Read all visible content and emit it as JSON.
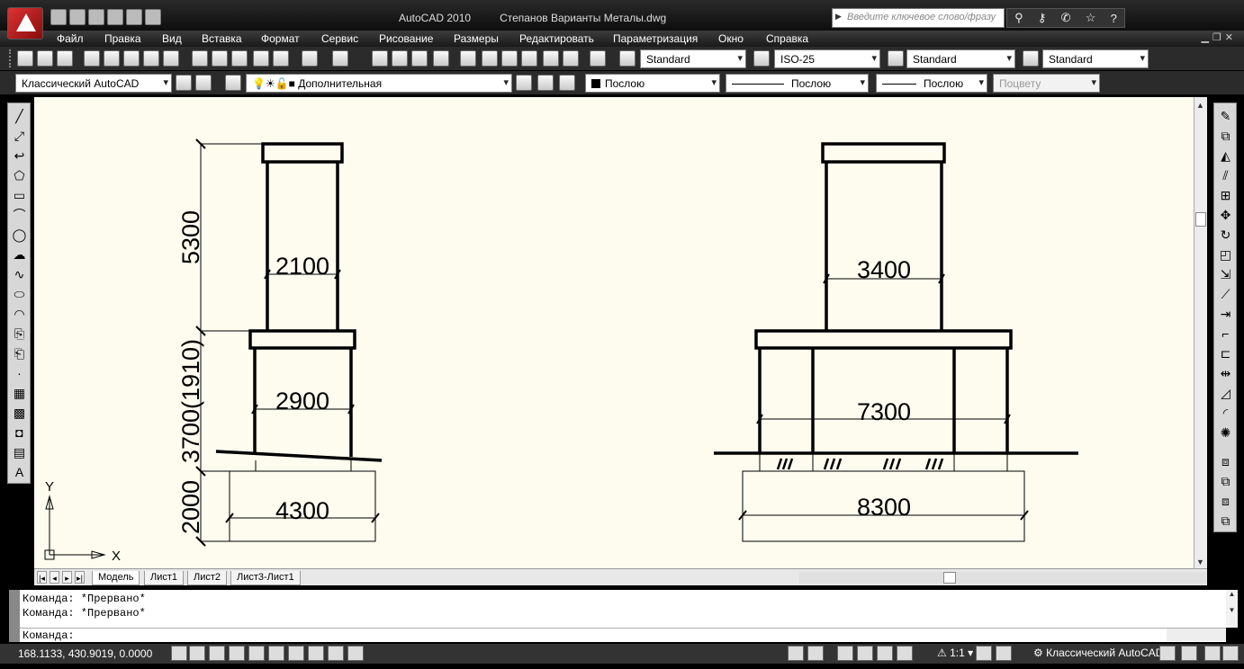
{
  "window": {
    "app_title": "AutoCAD 2010",
    "doc_title": "Степанов Варианты Металы.dwg",
    "search_placeholder": "Введите ключевое слово/фразу"
  },
  "menu": [
    "Файл",
    "Правка",
    "Вид",
    "Вставка",
    "Формат",
    "Сервис",
    "Рисование",
    "Размеры",
    "Редактировать",
    "Параметризация",
    "Окно",
    "Справка"
  ],
  "styles": {
    "text": "Standard",
    "dim": "ISO-25",
    "table": "Standard",
    "mleader": "Standard"
  },
  "layers": {
    "workspace": "Классический AutoCAD",
    "current_layer": "Дополнительная",
    "color": "Послою",
    "linetype": "Послою",
    "lineweight": "Послою",
    "plotstyle": "Поцвету"
  },
  "drawing": {
    "left": {
      "top_height": "5300",
      "mid_height": "3700(1910)",
      "base_height": "2000",
      "top_width": "2100",
      "mid_width": "2900",
      "base_width": "4300"
    },
    "right": {
      "top_width": "3400",
      "mid_width": "7300",
      "base_width": "8300"
    },
    "ucs": {
      "x": "X",
      "y": "Y"
    }
  },
  "tabs": {
    "model": "Модель",
    "sheets": [
      "Лист1",
      "Лист2",
      "Лист3-Лист1"
    ]
  },
  "command": {
    "history": [
      "Команда:  *Прервано*",
      "Команда:  *Прервано*"
    ],
    "prompt": "Команда:"
  },
  "status": {
    "coordinates": "168.1133, 430.9019, 0.0000",
    "annotation_scale": "1:1",
    "workspace": "Классический AutoCAD"
  }
}
